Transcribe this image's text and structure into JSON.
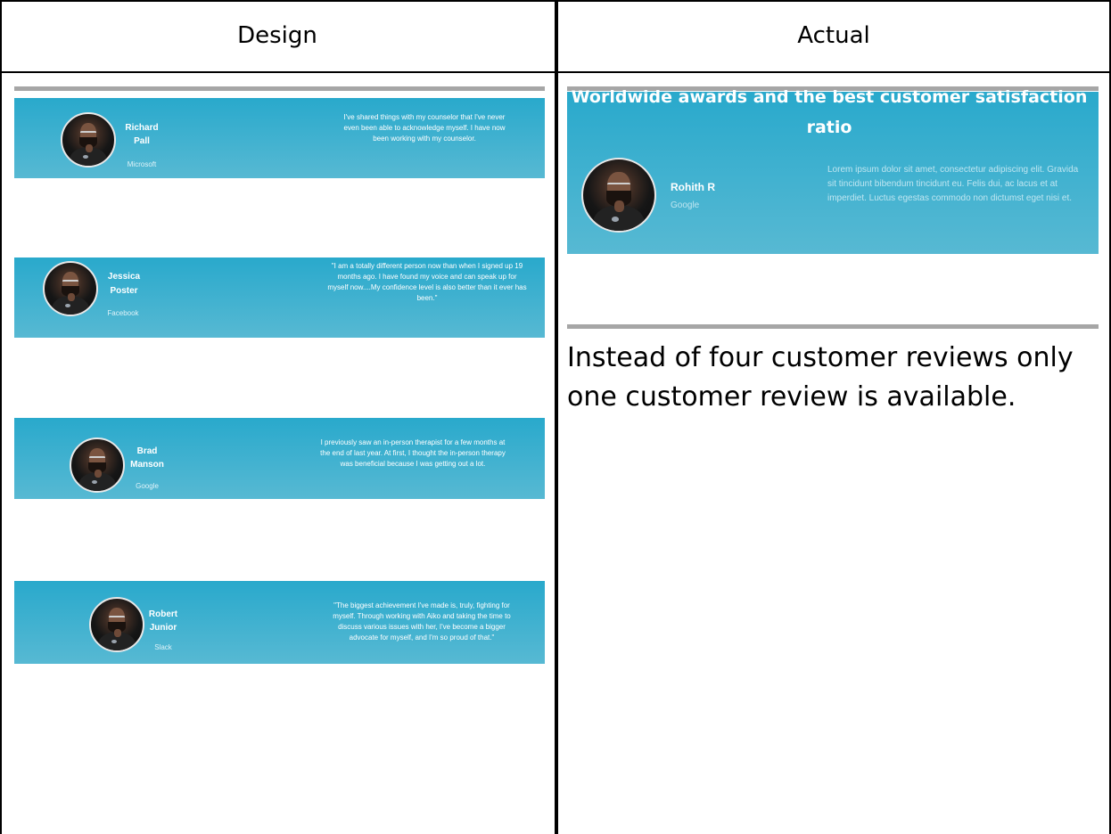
{
  "columns": {
    "design_title": "Design",
    "actual_title": "Actual"
  },
  "design": {
    "reviews": [
      {
        "name_line1": "Richard",
        "name_line2": "Pall",
        "company": "Microsoft",
        "quote": "I've shared things with my counselor that I've never even been able to acknowledge myself. I have now been working with my counselor."
      },
      {
        "name_line1": "Jessica",
        "name_line2": "Poster",
        "company": "Facebook",
        "quote": "\"I am a totally different person now than when I signed up 19 months ago. I have found my voice and can speak up for myself now....My confidence level is also better than it ever has been.\""
      },
      {
        "name_line1": "Brad",
        "name_line2": "Manson",
        "company": "Google",
        "quote": "I previously saw an in-person therapist for a few months at the end of last year. At first, I thought the in-person therapy was beneficial because I was getting out a lot."
      },
      {
        "name_line1": "Robert",
        "name_line2": "Junior",
        "company": "Slack",
        "quote": "\"The biggest achievement I've made is, truly, fighting for myself. Through working with Aiko and taking the time to discuss various issues with her, I've become a bigger advocate for myself, and I'm so proud of that.\""
      }
    ]
  },
  "actual": {
    "headline_line1": "Worldwide awards and the best customer satisfaction",
    "headline_line2": "ratio",
    "review": {
      "name": "Rohith R",
      "company": "Google",
      "quote": "Lorem ipsum dolor sit amet, consectetur adipiscing elit. Gravida sit tincidunt bibendum tincidunt eu. Felis dui, ac lacus et at imperdiet. Luctus egestas commodo non dictumst eget nisi et."
    },
    "note": "Instead of four customer reviews only one customer review is available."
  },
  "colors": {
    "banner_top": "#29a9cc",
    "banner_bottom": "#57b9d3",
    "rule_gray": "#a6a6a6"
  }
}
